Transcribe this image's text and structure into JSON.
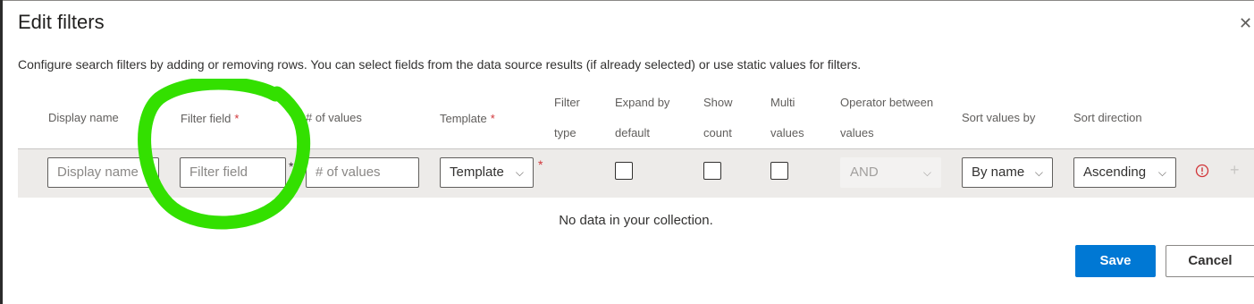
{
  "dialog": {
    "title": "Edit filters",
    "close_glyph": "✕",
    "description": "Configure search filters by adding or removing rows. You can select fields from the data source results (if already selected) or use static values for filters."
  },
  "columns": {
    "display_name": "Display name",
    "filter_field": "Filter field",
    "num_values": "# of values",
    "template": "Template",
    "filter_type_1": "Filter",
    "filter_type_2": "type",
    "expand_1": "Expand by",
    "expand_2": "default",
    "show_count_1": "Show",
    "show_count_2": "count",
    "multi_1": "Multi",
    "multi_2": "values",
    "operator_1": "Operator between",
    "operator_2": "values",
    "sort_by": "Sort values by",
    "sort_direction": "Sort direction",
    "required_mark": "*"
  },
  "row": {
    "display_name_placeholder": "Display name",
    "filter_field_placeholder": "Filter field",
    "num_values_placeholder": "# of values",
    "template_value": "Template",
    "operator_value": "AND",
    "sort_by_value": "By name",
    "sort_direction_value": "Ascending",
    "required_mark": "*",
    "chevron": "⌵",
    "add_glyph": "+",
    "expand_checked": false,
    "show_count_checked": false,
    "multi_checked": false
  },
  "empty_message": "No data in your collection.",
  "buttons": {
    "save": "Save",
    "cancel": "Cancel"
  },
  "colors": {
    "primary": "#0078d4",
    "required": "#d13438",
    "annotation": "#33e000"
  }
}
